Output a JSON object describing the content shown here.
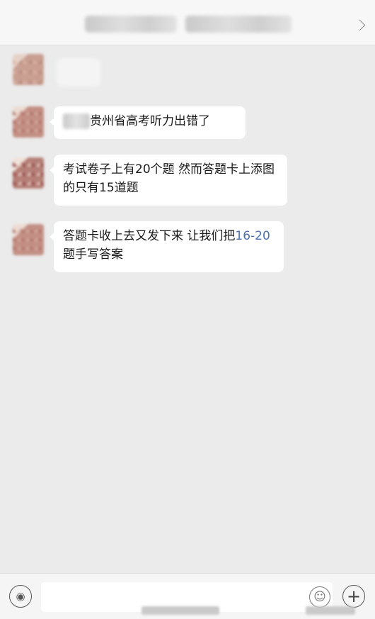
{
  "header": {
    "back_chevron": "chevron-right-icon"
  },
  "messages": [
    {
      "text_before": "",
      "text": "",
      "text_after": "",
      "redacted": true
    },
    {
      "text_before": "",
      "text": "贵州省高考听力出错了",
      "text_after": "",
      "redacted_prefix": true
    },
    {
      "text_before": "",
      "text": "考试卷子上有20个题  然而答题卡上添图的只有15道题",
      "text_after": ""
    },
    {
      "text_before": "答题卡收上去又发下来  让我们把",
      "link_text": "16-20",
      "text_after": "题手写答案"
    }
  ],
  "bottom_bar": {
    "voice_icon": "voice-icon",
    "emoji_icon": "emoji-icon",
    "plus_icon": "plus-icon"
  },
  "colors": {
    "background": "#ebebeb",
    "bubble": "#ffffff",
    "link": "#4a72b0"
  }
}
